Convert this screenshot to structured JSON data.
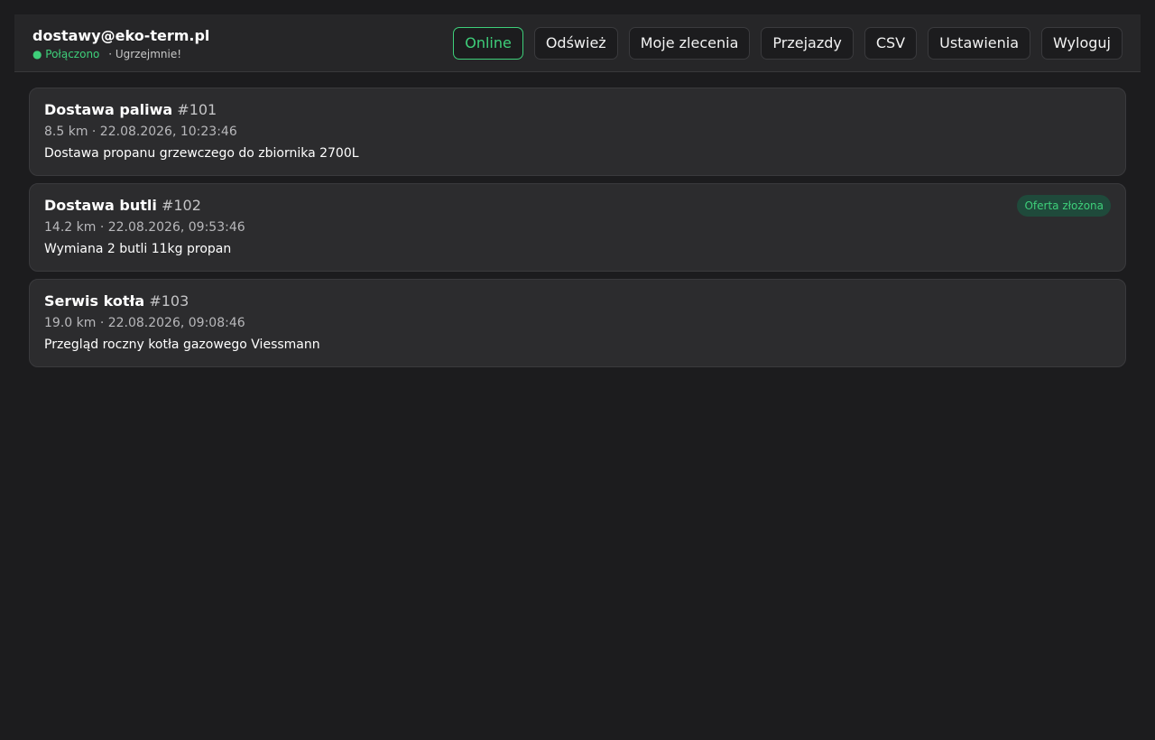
{
  "header": {
    "user_email": "dostawy@eko-term.pl",
    "status_connected": "● Połączono",
    "status_greeting": "· Ugrzejmnie!",
    "buttons": {
      "online": "Online",
      "refresh": "Odśwież",
      "my_orders": "Moje zlecenia",
      "trips": "Przejazdy",
      "csv": "CSV",
      "settings": "Ustawienia",
      "logout": "Wyloguj"
    }
  },
  "orders": [
    {
      "name": "Dostawa paliwa",
      "id": "#101",
      "meta": "8.5 km · 22.08.2026, 10:23:46",
      "description": "Dostawa propanu grzewczego do zbiornika 2700L",
      "badge": ""
    },
    {
      "name": "Dostawa butli",
      "id": "#102",
      "meta": "14.2 km · 22.08.2026, 09:53:46",
      "description": "Wymiana 2 butli 11kg propan",
      "badge": "Oferta złożona"
    },
    {
      "name": "Serwis kotła",
      "id": "#103",
      "meta": "19.0 km · 22.08.2026, 09:08:46",
      "description": "Przegląd roczny kotła gazowego Viessmann",
      "badge": ""
    }
  ],
  "colors": {
    "background": "#1c1c1e",
    "card": "#2c2c2e",
    "accent_green": "#3ecf7a",
    "badge_bg": "#1f4a3b"
  }
}
